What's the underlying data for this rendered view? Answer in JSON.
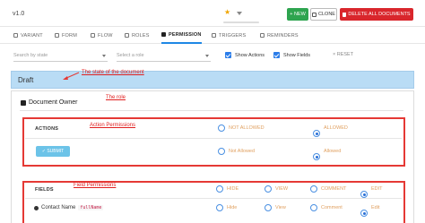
{
  "header": {
    "version": "v1.0",
    "new_label": "+ NEW",
    "clone_label": "CLONE",
    "delete_label": "DELETE ALL DOCUMENTS"
  },
  "tabs": [
    {
      "label": "VARIANT",
      "icon": "variant-icon"
    },
    {
      "label": "FORM",
      "icon": "form-icon"
    },
    {
      "label": "FLOW",
      "icon": "flow-icon"
    },
    {
      "label": "ROLES",
      "icon": "roles-icon"
    },
    {
      "label": "PERMISSION",
      "icon": "shield-icon",
      "active": true
    },
    {
      "label": "TRIGGERS",
      "icon": "trigger-icon"
    },
    {
      "label": "REMINDERS",
      "icon": "bell-icon"
    }
  ],
  "filters": {
    "state_placeholder": "Search by state",
    "role_placeholder": "Select a role",
    "show_actions": "Show Actions",
    "show_fields": "Show Fields",
    "reset": "× RESET"
  },
  "state": {
    "name": "Draft",
    "annotation": "The state of the document"
  },
  "role": {
    "name": "Document Owner",
    "annotation": "The role"
  },
  "actions": {
    "annotation": "Action Permissions",
    "header": "ACTIONS",
    "not_allowed": "NOT ALLOWED",
    "allowed": "ALLOWED",
    "rows": [
      {
        "button": "✓ SUBMIT",
        "not_allowed": "Not Allowed",
        "allowed": "Allowed",
        "selected": "allowed"
      }
    ]
  },
  "fields": {
    "annotation": "Field Permissions",
    "header": "FIELDS",
    "options": [
      "HIDE",
      "VIEW",
      "COMMENT",
      "EDIT"
    ],
    "rows": [
      {
        "label": "Contact Name",
        "code": "fullName",
        "options": [
          "Hide",
          "View",
          "Comment",
          "Edit"
        ],
        "selected": "Edit"
      }
    ]
  },
  "colors": {
    "accent": "#1e88e5",
    "new": "#2ea44f",
    "delete": "#d9262c",
    "annotation": "#e53935",
    "draft_bg": "#b9dcf5"
  }
}
